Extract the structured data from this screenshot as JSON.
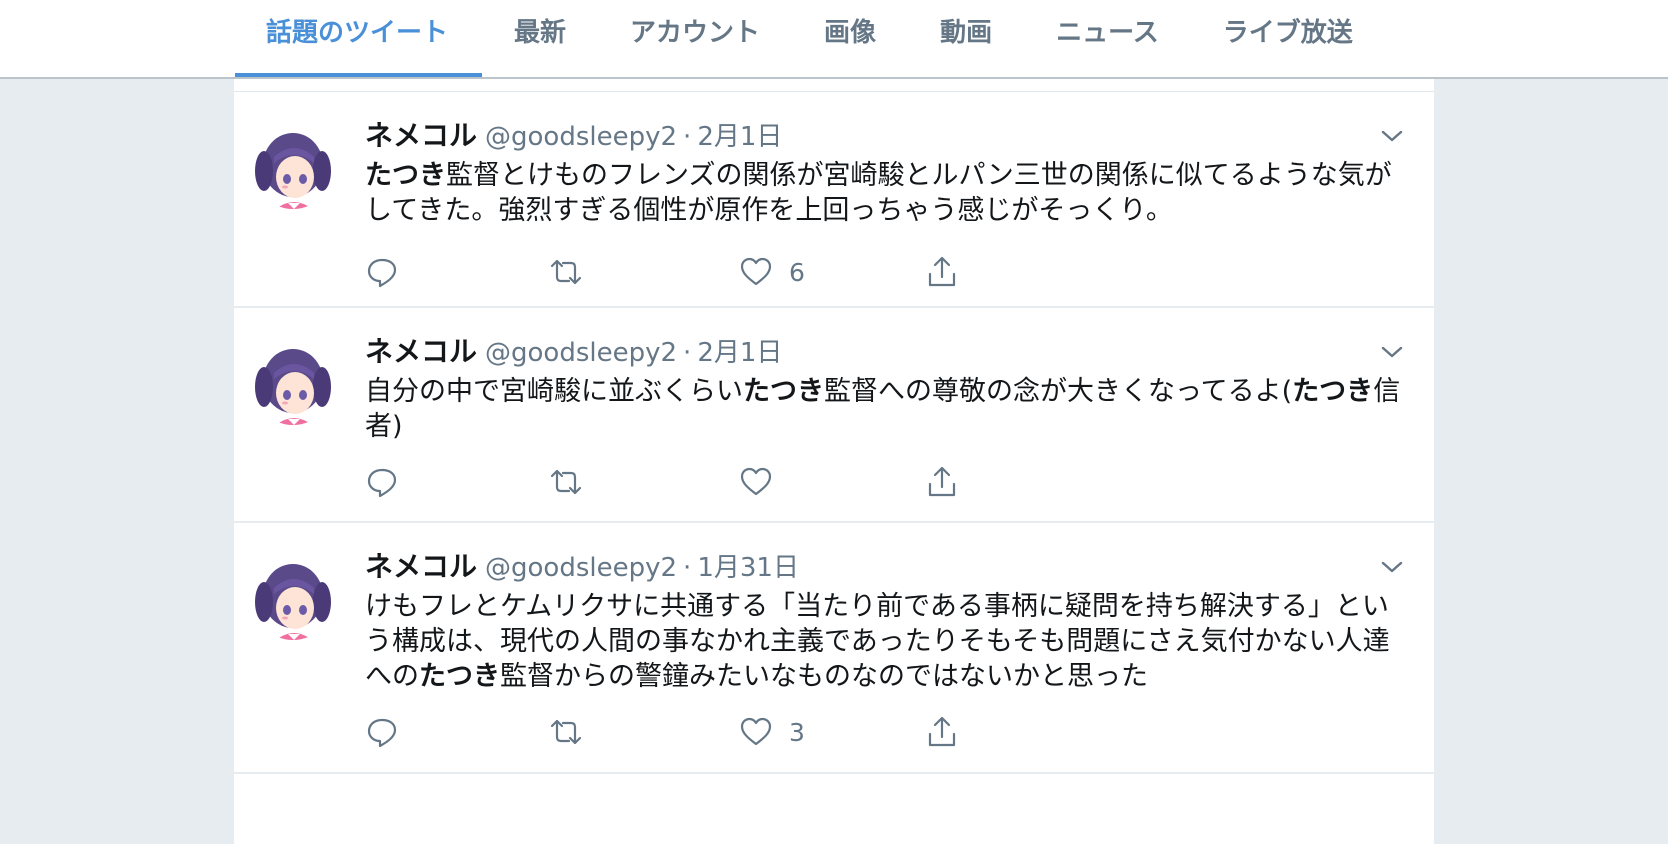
{
  "tabs": [
    {
      "label": "話題のツイート",
      "active": true
    },
    {
      "label": "最新"
    },
    {
      "label": "アカウント"
    },
    {
      "label": "画像"
    },
    {
      "label": "動画"
    },
    {
      "label": "ニュース"
    },
    {
      "label": "ライブ放送"
    }
  ],
  "colors": {
    "accent": "#4a90d9",
    "muted": "#657786",
    "text": "#14171a",
    "background": "#e6ecf0"
  },
  "tweets": [
    {
      "name": "ネメコル",
      "handle": "@goodsleepy2",
      "separator": "·",
      "date": "2月1日",
      "text_segments": [
        {
          "text": "たつき",
          "bold": true
        },
        {
          "text": "監督とけものフレンズの関係が宮崎駿とルパン三世の関係に似てるような気がしてきた。強烈すぎる個性が原作を上回っちゃう感じがそっくり。"
        }
      ],
      "likes": "6"
    },
    {
      "name": "ネメコル",
      "handle": "@goodsleepy2",
      "separator": "·",
      "date": "2月1日",
      "text_segments": [
        {
          "text": "自分の中で宮崎駿に並ぶくらい"
        },
        {
          "text": "たつき",
          "bold": true
        },
        {
          "text": "監督への尊敬の念が大きくなってるよ("
        },
        {
          "text": "たつき",
          "bold": true
        },
        {
          "text": "信者)"
        }
      ],
      "likes": ""
    },
    {
      "name": "ネメコル",
      "handle": "@goodsleepy2",
      "separator": "·",
      "date": "1月31日",
      "text_segments": [
        {
          "text": "けもフレとケムリクサに共通する「当たり前である事柄に疑問を持ち解決する」という構成は、現代の人間の事なかれ主義であったりそもそも問題にさえ気付かない人達への"
        },
        {
          "text": "たつき",
          "bold": true
        },
        {
          "text": "監督からの警鐘みたいなものなのではないかと思った"
        }
      ],
      "likes": "3"
    }
  ],
  "icons": {
    "reply": "reply-icon",
    "retweet": "retweet-icon",
    "like": "heart-icon",
    "share": "share-icon",
    "menu": "chevron-down-icon",
    "avatar": "avatar"
  }
}
